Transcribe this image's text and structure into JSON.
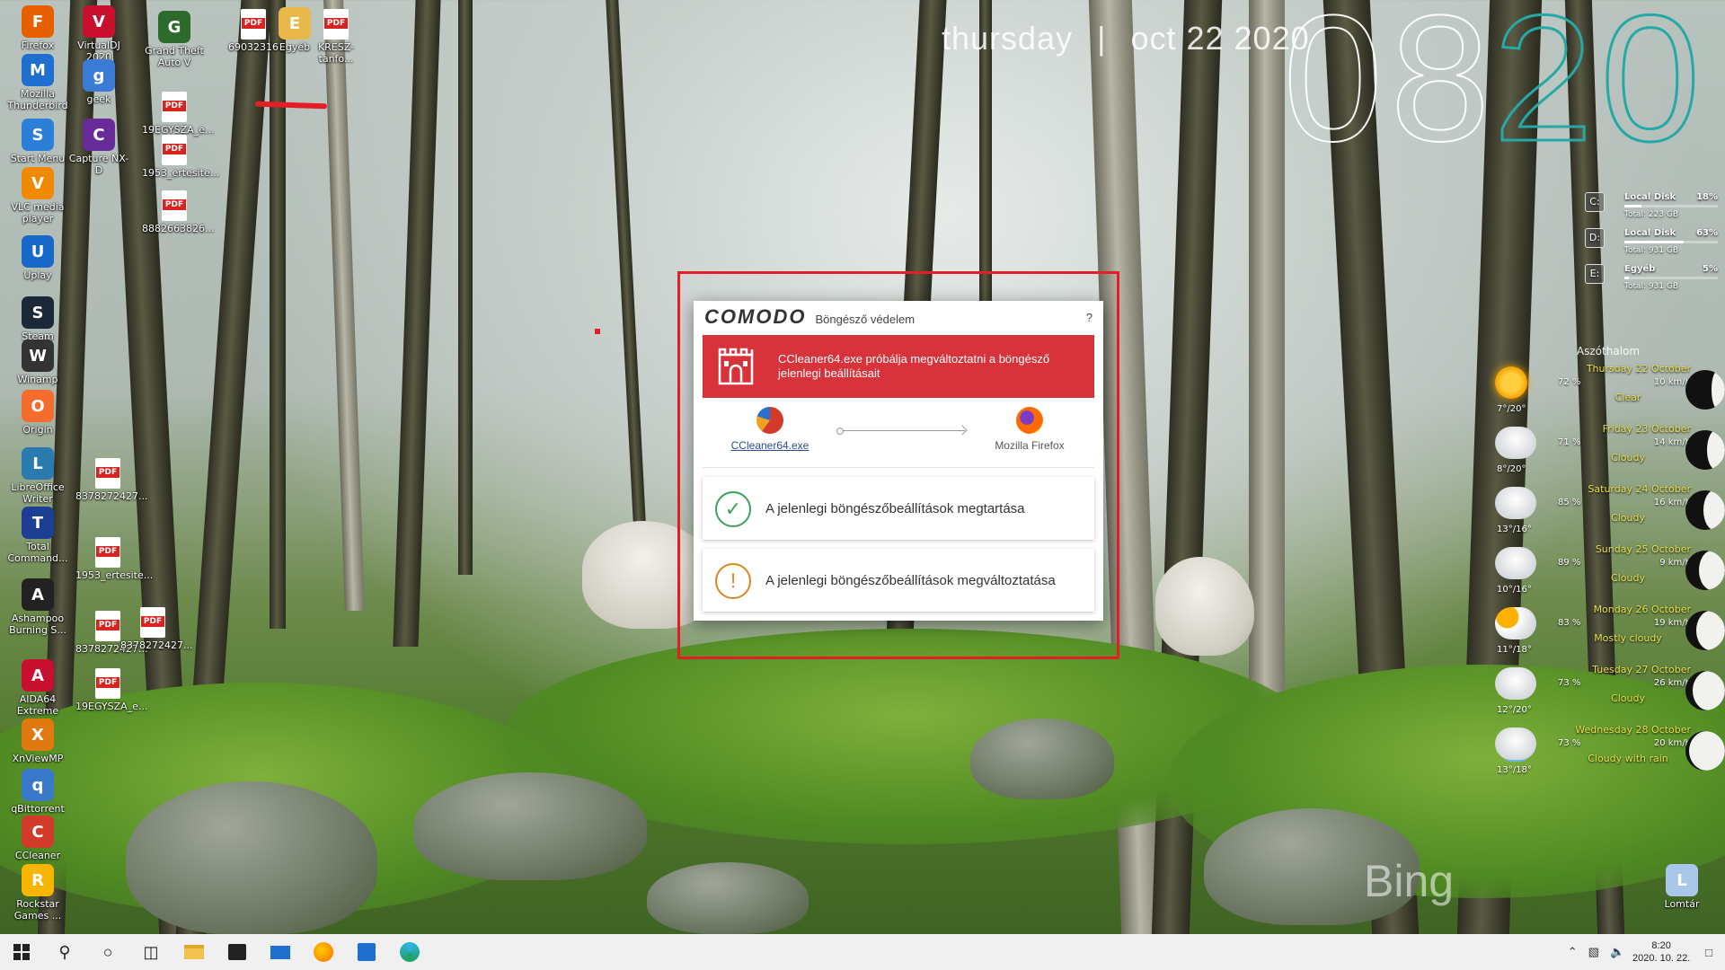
{
  "desktop": {
    "icons": [
      {
        "label": "Firefox",
        "glyph": "firefox-icon",
        "color": "#e66000"
      },
      {
        "label": "VirtualDJ 2020",
        "glyph": "virtualdj-icon",
        "color": "#c8102e"
      },
      {
        "label": "Grand Theft Auto V",
        "glyph": "gta-icon",
        "color": "#2d6b2d"
      },
      {
        "label": "69032316",
        "glyph": "pdf-icon"
      },
      {
        "label": "Egyéb",
        "glyph": "folder-icon",
        "color": "#e8b84a"
      },
      {
        "label": "KRESZ-tanfo...",
        "glyph": "pdf-icon"
      },
      {
        "label": "Mozilla Thunderbird",
        "glyph": "thunderbird-icon",
        "color": "#1f6fd0"
      },
      {
        "label": "geek",
        "glyph": "geek-icon",
        "color": "#3a7bd5"
      },
      {
        "label": "19EGYSZA_e...",
        "glyph": "pdf-icon"
      },
      {
        "label": "Start Menu",
        "glyph": "start-menu-icon",
        "color": "#2b7fd6"
      },
      {
        "label": "Capture NX-D",
        "glyph": "capture-nxd-icon",
        "color": "#6a2b9a"
      },
      {
        "label": "1953_ertesite...",
        "glyph": "pdf-icon"
      },
      {
        "label": "VLC media player",
        "glyph": "vlc-icon",
        "color": "#f08a00"
      },
      {
        "label": "8882663826...",
        "glyph": "pdf-icon"
      },
      {
        "label": "Uplay",
        "glyph": "uplay-icon",
        "color": "#1769c9"
      },
      {
        "label": "Steam",
        "glyph": "steam-icon",
        "color": "#1b2838"
      },
      {
        "label": "Winamp",
        "glyph": "winamp-icon",
        "color": "#333333"
      },
      {
        "label": "Origin",
        "glyph": "origin-icon",
        "color": "#f56c2d"
      },
      {
        "label": "LibreOffice Writer",
        "glyph": "libreoffice-icon",
        "color": "#2a7ab0"
      },
      {
        "label": "8378272427...",
        "glyph": "pdf-icon"
      },
      {
        "label": "Total Command...",
        "glyph": "total-commander-icon",
        "color": "#1c3f94"
      },
      {
        "label": "1953_ertesite...",
        "glyph": "pdf-icon"
      },
      {
        "label": "Ashampoo Burning S...",
        "glyph": "ashampoo-icon",
        "color": "#222222"
      },
      {
        "label": "8378272427...",
        "glyph": "pdf-icon"
      },
      {
        "label": "8378272427...",
        "glyph": "pdf-icon"
      },
      {
        "label": "AIDA64 Extreme",
        "glyph": "aida64-icon",
        "color": "#c8102e"
      },
      {
        "label": "19EGYSZA_e...",
        "glyph": "pdf-icon"
      },
      {
        "label": "XnViewMP",
        "glyph": "xnview-icon",
        "color": "#e07a10"
      },
      {
        "label": "qBittorrent",
        "glyph": "qbittorrent-icon",
        "color": "#3a78c9"
      },
      {
        "label": "CCleaner",
        "glyph": "ccleaner-icon",
        "color": "#d23a2a"
      },
      {
        "label": "Rockstar Games ...",
        "glyph": "rockstar-icon",
        "color": "#f7b500"
      },
      {
        "label": "Lomtár",
        "glyph": "recycle-bin-icon",
        "color": "#a9c7e8"
      }
    ]
  },
  "datewidget": {
    "day": "thursday",
    "date": "oct 22 2020",
    "hour": "08",
    "minute": "20",
    "hour_color": "#ffffff",
    "minute_color": "#25a9a6"
  },
  "disks": [
    {
      "letter": "C:",
      "name": "Local Disk",
      "percent_label": "18%",
      "percent": 18,
      "total": "Total: 223 GB"
    },
    {
      "letter": "D:",
      "name": "Local Disk",
      "percent_label": "63%",
      "percent": 63,
      "total": "Total: 931 GB"
    },
    {
      "letter": "E:",
      "name": "Egyéb",
      "percent_label": "5%",
      "percent": 5,
      "total": "Total: 931 GB"
    }
  ],
  "weather": {
    "city": "Aszóthalom",
    "days": [
      {
        "day": "Thursday 22 October",
        "humidity": "72 %",
        "wind": "10 km/h",
        "cond": "Clear",
        "temp": "7°/20°",
        "icon": "sun-icon",
        "moon": 0.35
      },
      {
        "day": "Friday 23 October",
        "humidity": "71 %",
        "wind": "14 km/h",
        "cond": "Cloudy",
        "temp": "8°/20°",
        "icon": "cloud-icon",
        "moon": 0.45
      },
      {
        "day": "Saturday 24 October",
        "humidity": "85 %",
        "wind": "16 km/h",
        "cond": "Cloudy",
        "temp": "13°/16°",
        "icon": "cloud-icon",
        "moon": 0.55
      },
      {
        "day": "Sunday 25 October",
        "humidity": "89 %",
        "wind": "9 km/h",
        "cond": "Cloudy",
        "temp": "10°/16°",
        "icon": "cloud-icon",
        "moon": 0.65
      },
      {
        "day": "Monday 26 October",
        "humidity": "83 %",
        "wind": "19 km/h",
        "cond": "Mostly cloudy",
        "temp": "11°/18°",
        "icon": "partly-cloudy-icon",
        "moon": 0.72
      },
      {
        "day": "Tuesday 27 October",
        "humidity": "73 %",
        "wind": "26 km/h",
        "cond": "Cloudy",
        "temp": "12°/20°",
        "icon": "cloud-icon",
        "moon": 0.82
      },
      {
        "day": "Wednesday 28 October",
        "humidity": "73 %",
        "wind": "20 km/h",
        "cond": "Cloudy with rain",
        "temp": "13°/18°",
        "icon": "rain-cloud-icon",
        "moon": 0.9
      }
    ]
  },
  "dialog": {
    "brand": "COMODO",
    "title": "Böngésző védelem",
    "help": "?",
    "alert": "CCleaner64.exe próbálja megváltoztatni a böngésző jelenlegi beállításait",
    "source_app": "CCleaner64.exe",
    "target_app": "Mozilla Firefox",
    "option_keep": "A jelenlegi böngészőbeállítások megtartása",
    "option_change": "A jelenlegi böngészőbeállítások megváltoztatása",
    "alert_color": "#d8333b",
    "keep_color": "#3aa35a",
    "change_color": "#d9881e"
  },
  "wallpaper_brand": "Bing",
  "taskbar": {
    "time": "8:20",
    "date": "2020. 10. 22."
  }
}
